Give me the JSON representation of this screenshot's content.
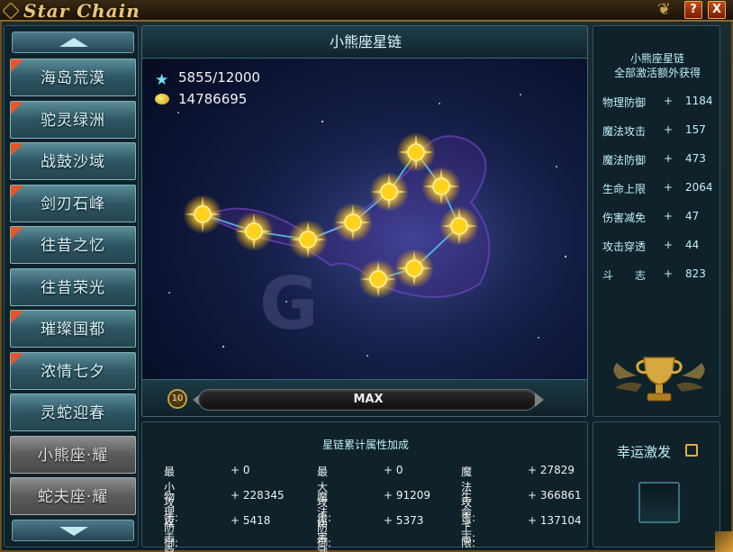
{
  "window": {
    "title": "Star Chain",
    "help_label": "?",
    "close_label": "X"
  },
  "sidebar": {
    "items": [
      {
        "label": "海岛荒漠",
        "flag": true,
        "locked": false
      },
      {
        "label": "驼灵绿洲",
        "flag": true,
        "locked": false
      },
      {
        "label": "战鼓沙域",
        "flag": true,
        "locked": false
      },
      {
        "label": "剑刃石峰",
        "flag": true,
        "locked": false
      },
      {
        "label": "往昔之忆",
        "flag": true,
        "locked": false
      },
      {
        "label": "往昔荣光",
        "flag": false,
        "locked": false
      },
      {
        "label": "璀璨国都",
        "flag": true,
        "locked": false
      },
      {
        "label": "浓情七夕",
        "flag": true,
        "locked": false
      },
      {
        "label": "灵蛇迎春",
        "flag": false,
        "locked": false
      },
      {
        "label": "小熊座·耀",
        "flag": false,
        "locked": true
      },
      {
        "label": "蛇夫座·耀",
        "flag": false,
        "locked": true
      }
    ]
  },
  "main": {
    "title": "小熊座星链",
    "star_progress": "5855/12000",
    "gold": "14786695",
    "level": "10",
    "progress_text": "MAX",
    "watermark": "G"
  },
  "bonus": {
    "title_line1": "小熊座星链",
    "title_line2": "全部激活额外获得",
    "rows": [
      {
        "label": "物理防御",
        "plus": "+",
        "value": "1184"
      },
      {
        "label": "魔法攻击",
        "plus": "+",
        "value": "157"
      },
      {
        "label": "魔法防御",
        "plus": "+",
        "value": "473"
      },
      {
        "label": "生命上限",
        "plus": "+",
        "value": "2064"
      },
      {
        "label": "伤害减免",
        "plus": "+",
        "value": "47"
      },
      {
        "label": "攻击穿透",
        "plus": "+",
        "value": "44"
      },
      {
        "label": "斗　　志",
        "plus": "+",
        "value": "823"
      }
    ]
  },
  "bottom": {
    "title": "星链累计属性加成",
    "cells": [
      {
        "label": "最小攻击:",
        "value": "+ 0"
      },
      {
        "label": "最大攻击:",
        "value": "+ 0"
      },
      {
        "label": "魔法攻击:",
        "value": "+ 27829"
      },
      {
        "label": "物理防御:",
        "value": "+ 228345"
      },
      {
        "label": "魔法防御:",
        "value": "+ 91209"
      },
      {
        "label": "生命上限:",
        "value": "+ 366861"
      },
      {
        "label": "攻击穿透:",
        "value": "+ 5418"
      },
      {
        "label": "伤害减免:",
        "value": "+ 5373"
      },
      {
        "label": "斗　　志:",
        "value": "+ 137104"
      }
    ]
  },
  "lucky": {
    "label": "幸运激发",
    "checked": false
  },
  "colors": {
    "accent": "#bff0f7",
    "gold": "#ffd84a",
    "flag": "#e8552a"
  },
  "icons": [
    "star-icon",
    "coin-icon",
    "trophy-icon",
    "chevron-up-icon",
    "chevron-down-icon"
  ]
}
